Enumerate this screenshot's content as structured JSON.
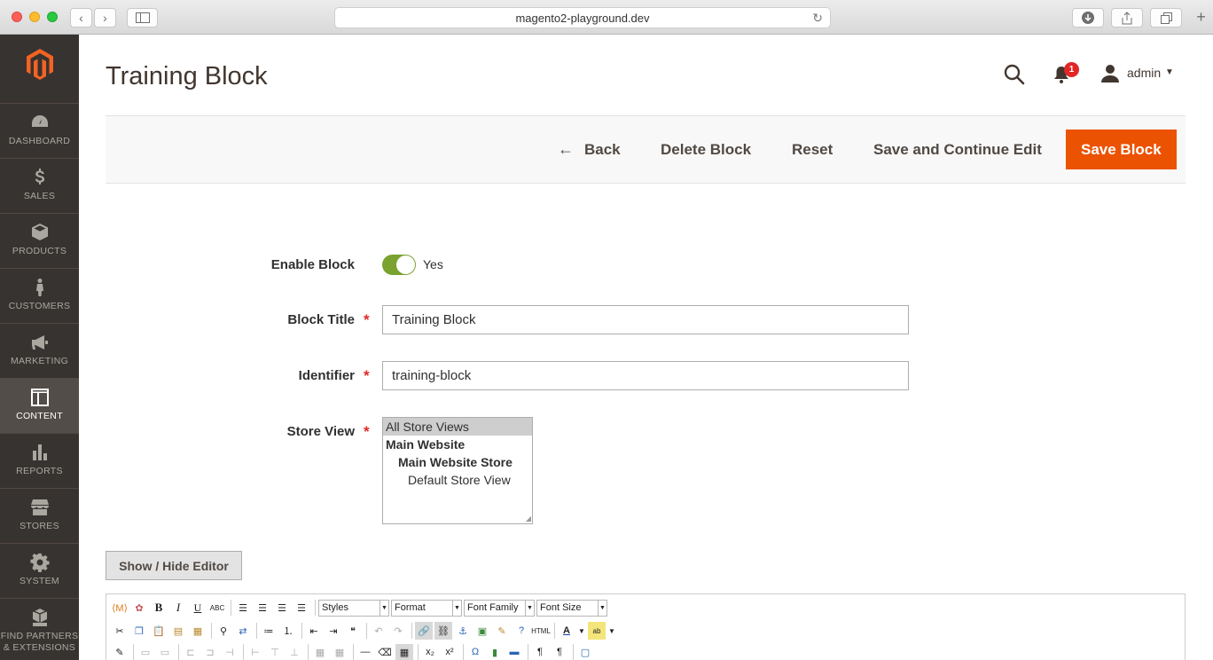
{
  "browser": {
    "url": "magento2-playground.dev"
  },
  "sidebar": {
    "items": [
      {
        "label": "DASHBOARD",
        "icon": "dashboard-icon"
      },
      {
        "label": "SALES",
        "icon": "dollar-icon"
      },
      {
        "label": "PRODUCTS",
        "icon": "cube-icon"
      },
      {
        "label": "CUSTOMERS",
        "icon": "person-icon"
      },
      {
        "label": "MARKETING",
        "icon": "megaphone-icon"
      },
      {
        "label": "CONTENT",
        "icon": "layout-icon",
        "active": true
      },
      {
        "label": "REPORTS",
        "icon": "bar-chart-icon"
      },
      {
        "label": "STORES",
        "icon": "store-icon"
      },
      {
        "label": "SYSTEM",
        "icon": "gear-icon"
      },
      {
        "label": "FIND PARTNERS",
        "label2": "& EXTENSIONS",
        "icon": "boxes-icon"
      }
    ]
  },
  "header": {
    "title": "Training Block",
    "notifications": "1",
    "user": "admin"
  },
  "actions": {
    "back": "Back",
    "delete": "Delete Block",
    "reset": "Reset",
    "save_continue": "Save and Continue Edit",
    "save": "Save Block"
  },
  "form": {
    "enable": {
      "label": "Enable Block",
      "value": "Yes",
      "on": true
    },
    "title": {
      "label": "Block Title",
      "value": "Training Block"
    },
    "identifier": {
      "label": "Identifier",
      "value": "training-block"
    },
    "store_view": {
      "label": "Store View",
      "options": [
        "All Store Views",
        "Main Website",
        "Main Website Store",
        "Default Store View"
      ],
      "selected": "All Store Views"
    }
  },
  "editor": {
    "show_hide": "Show / Hide Editor",
    "styles": "Styles",
    "format": "Format",
    "font_family": "Font Family",
    "font_size": "Font Size"
  },
  "colors": {
    "sidebar_bg": "#373330",
    "primary_button": "#eb5202",
    "toggle_on": "#79a22e",
    "badge": "#e22626"
  }
}
